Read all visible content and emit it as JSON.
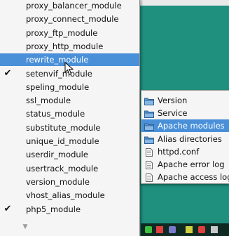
{
  "module_list": {
    "items": [
      {
        "label": "proxy_balancer_module",
        "checked": false,
        "highlighted": false
      },
      {
        "label": "proxy_connect_module",
        "checked": false,
        "highlighted": false
      },
      {
        "label": "proxy_ftp_module",
        "checked": false,
        "highlighted": false
      },
      {
        "label": "proxy_http_module",
        "checked": false,
        "highlighted": false
      },
      {
        "label": "rewrite_module",
        "checked": false,
        "highlighted": true
      },
      {
        "label": "setenvif_module",
        "checked": true,
        "highlighted": false
      },
      {
        "label": "speling_module",
        "checked": false,
        "highlighted": false
      },
      {
        "label": "ssl_module",
        "checked": false,
        "highlighted": false
      },
      {
        "label": "status_module",
        "checked": false,
        "highlighted": false
      },
      {
        "label": "substitute_module",
        "checked": false,
        "highlighted": false
      },
      {
        "label": "unique_id_module",
        "checked": false,
        "highlighted": false
      },
      {
        "label": "userdir_module",
        "checked": false,
        "highlighted": false
      },
      {
        "label": "usertrack_module",
        "checked": false,
        "highlighted": false
      },
      {
        "label": "version_module",
        "checked": false,
        "highlighted": false
      },
      {
        "label": "vhost_alias_module",
        "checked": false,
        "highlighted": false
      },
      {
        "label": "php5_module",
        "checked": true,
        "highlighted": false
      }
    ],
    "check_glyph": "✔",
    "scroll_glyph": "▼"
  },
  "submenu": {
    "items": [
      {
        "label": "Version",
        "icon": "folder-icon",
        "highlighted": false
      },
      {
        "label": "Service",
        "icon": "folder-icon",
        "highlighted": false
      },
      {
        "label": "Apache modules",
        "icon": "folder-icon",
        "highlighted": true
      },
      {
        "label": "Alias directories",
        "icon": "folder-icon",
        "highlighted": false
      },
      {
        "label": "httpd.conf",
        "icon": "document-icon",
        "highlighted": false
      },
      {
        "label": "Apache error log",
        "icon": "document-icon",
        "highlighted": false
      },
      {
        "label": "Apache access log",
        "icon": "document-icon",
        "highlighted": false
      }
    ]
  },
  "tray": {
    "icons": [
      "network-icon",
      "flag-icon",
      "shield-icon",
      "battery-icon",
      "computer-icon",
      "volume-icon"
    ]
  },
  "colors": {
    "highlight": "#4a90d9",
    "menu_bg": "#f5f5f5",
    "desktop": "#1f8f7e",
    "taskbar": "#0e2a22"
  }
}
